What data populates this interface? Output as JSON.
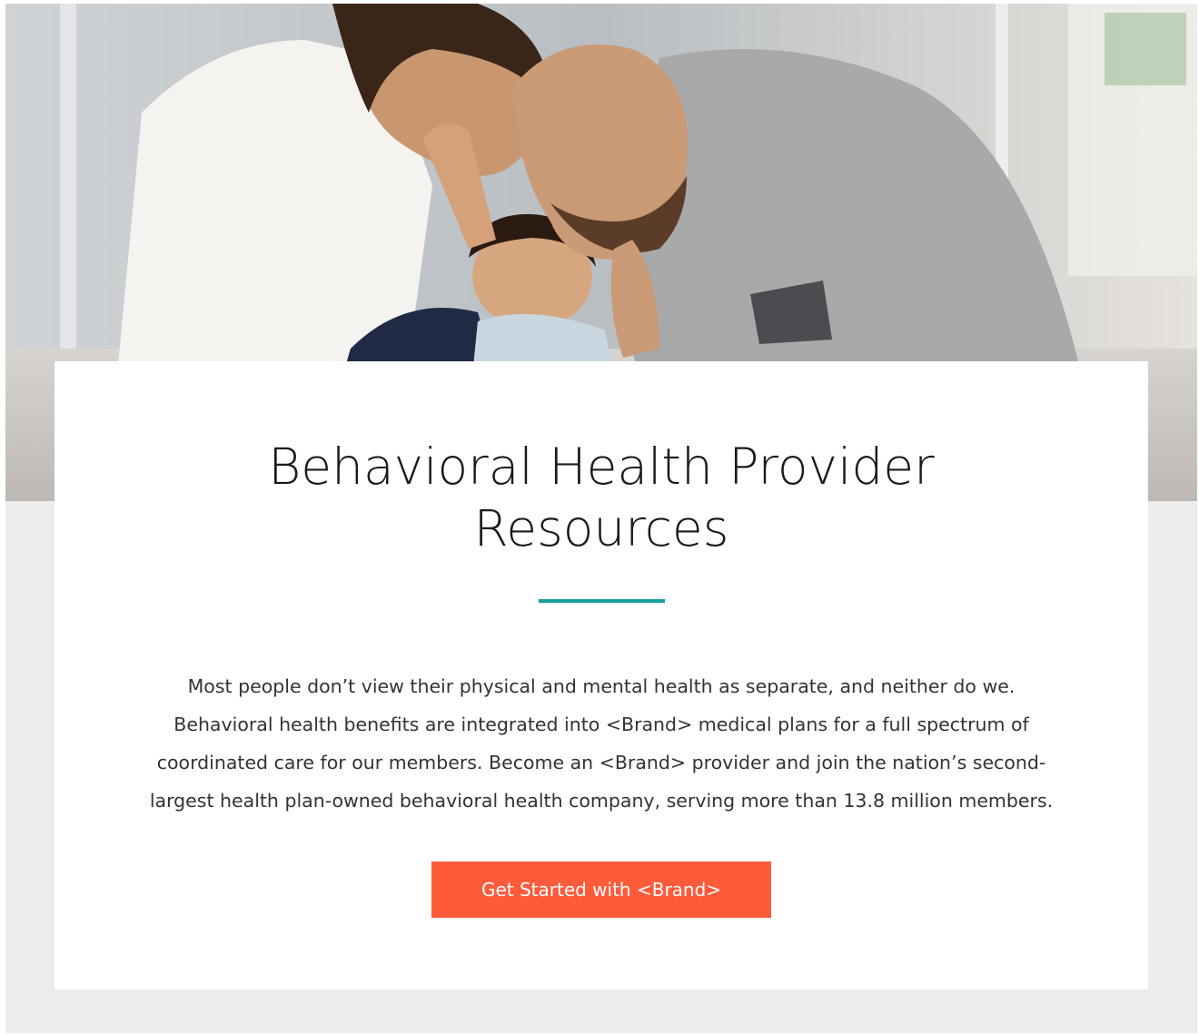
{
  "hero": {
    "image_description_icon": "family-photo",
    "alt": ""
  },
  "card": {
    "title_line_1": "Behavioral Health Provider",
    "title_line_2": "Resources",
    "body_lines": [
      "Most people don’t view their physical and mental health as separate, and neither do we.",
      "Behavioral health benefits are integrated into <Brand> medical plans for a full spectrum of",
      "coordinated care for our members. Become an <Brand> provider and join the nation’s second-",
      "largest health plan-owned behavioral health company, serving more than 13.8 million members."
    ],
    "cta_label": "Get Started with <Brand>"
  },
  "colors": {
    "accent_teal": "#149f9f",
    "cta_orange": "#fe5b3b",
    "page_gray": "#ececec",
    "card_white": "#ffffff"
  }
}
